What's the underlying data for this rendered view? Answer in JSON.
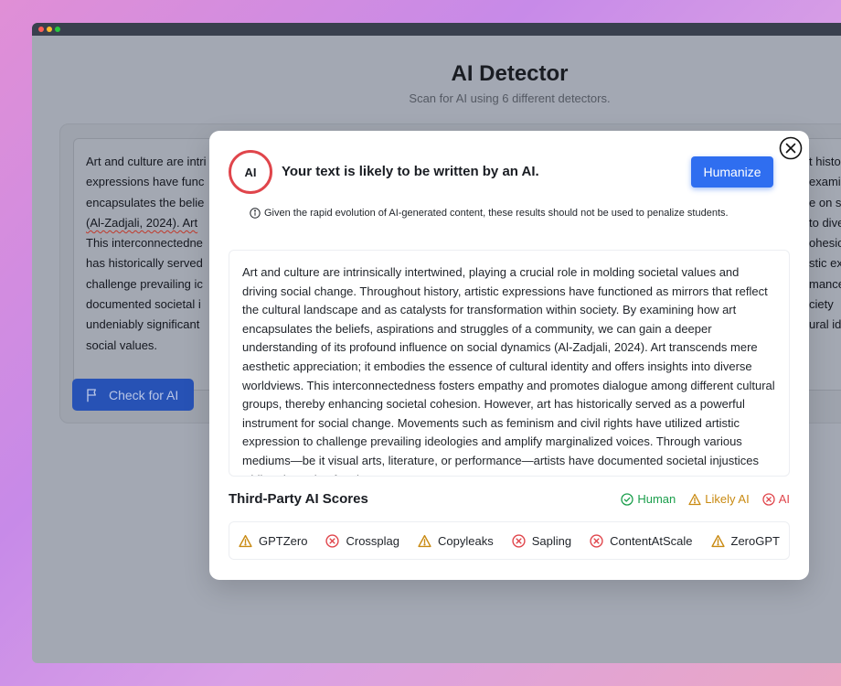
{
  "app": {
    "title": "AI Detector",
    "subtitle": "Scan for AI using 6 different detectors."
  },
  "background": {
    "text_lines": [
      "Art and culture are intri",
      "expressions have func",
      "encapsulates the belie",
      "(Al-Zadjali, 2024). Art",
      "This interconnectedne",
      "has historically served",
      "challenge prevailing ic",
      "documented societal i",
      "undeniably significant",
      "social values."
    ],
    "right_fragments": [
      "t histo",
      "examin",
      "e on s",
      "to dive",
      "ohesion",
      "stic ex",
      "mance",
      "ciety",
      "ural id"
    ],
    "check_button_label": "Check for AI"
  },
  "modal": {
    "badge_label": "AI",
    "headline": "Your text is likely to be written by an AI.",
    "humanize_label": "Humanize",
    "notice": "Given the rapid evolution of AI-generated content, these results should not be used to penalize students.",
    "text": "Art and culture are intrinsically intertwined, playing a crucial role in molding societal values and driving social change. Throughout history, artistic expressions have functioned as mirrors that reflect the cultural landscape and as catalysts for transformation within society. By examining how art encapsulates the beliefs, aspirations and struggles of a community, we can gain a deeper understanding of its profound influence on social dynamics (Al-Zadjali, 2024). Art transcends mere aesthetic appreciation; it embodies the essence of cultural identity and offers insights into diverse worldviews. This interconnectedness fosters empathy and promotes dialogue among different cultural groups, thereby enhancing societal cohesion. However, art has historically served as a powerful instrument for social change. Movements such as feminism and civil rights have utilized artistic expression to challenge prevailing ideologies and amplify marginalized voices. Through various mediums—be it visual arts, literature, or performance—artists have documented societal injustices while advocating for change.",
    "scores_title": "Third-Party AI Scores",
    "legend": [
      {
        "label": "Human",
        "icon": "check-circle-icon",
        "color": "#1a9e4b"
      },
      {
        "label": "Likely AI",
        "icon": "warning-icon",
        "color": "#c98a12"
      },
      {
        "label": "AI",
        "icon": "x-circle-icon",
        "color": "#e0454b"
      }
    ],
    "detectors": [
      {
        "name": "GPTZero",
        "status": "likely-ai",
        "icon": "warning-icon"
      },
      {
        "name": "Crossplag",
        "status": "ai",
        "icon": "x-circle-icon"
      },
      {
        "name": "Copyleaks",
        "status": "likely-ai",
        "icon": "warning-icon"
      },
      {
        "name": "Sapling",
        "status": "ai",
        "icon": "x-circle-icon"
      },
      {
        "name": "ContentAtScale",
        "status": "ai",
        "icon": "x-circle-icon"
      },
      {
        "name": "ZeroGPT",
        "status": "likely-ai",
        "icon": "warning-icon"
      }
    ]
  },
  "colors": {
    "ai_red": "#e0454b",
    "warning_amber": "#c98a12",
    "human_green": "#1a9e4b",
    "primary_blue": "#2f6ef0"
  }
}
